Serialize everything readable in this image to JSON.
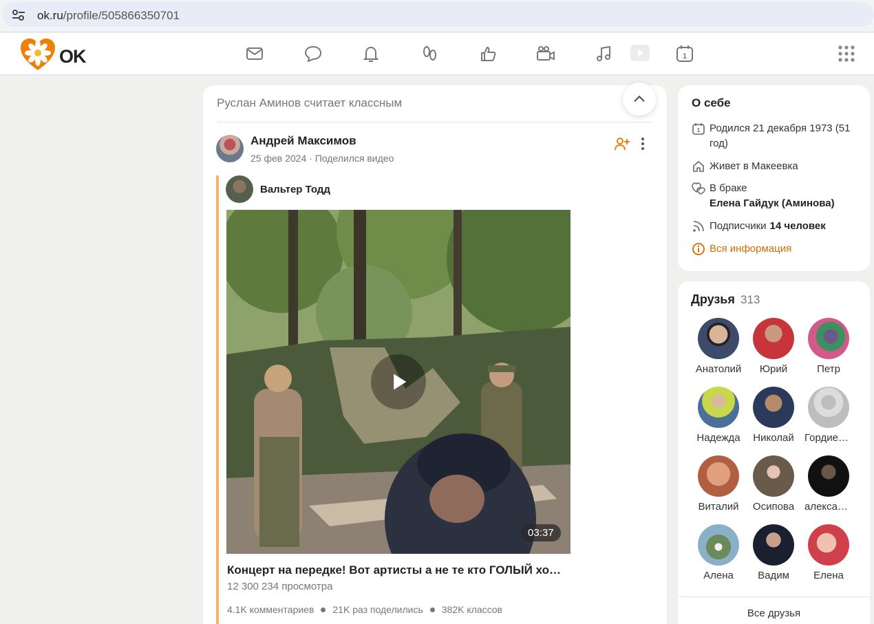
{
  "browser": {
    "url_host": "ok.ru",
    "url_path": "/profile/505866350701"
  },
  "header": {
    "logo_text": "OK",
    "nav_icons": [
      "messages-icon",
      "discussions-icon",
      "notifications-icon",
      "guests-icon",
      "marks-icon",
      "video-icon",
      "music-icon",
      "games-icon",
      "calendar-icon",
      "apps-grid-icon"
    ],
    "accent_color": "#ee8208"
  },
  "feed": {
    "liked_by": "Руслан Аминов считает классным",
    "post": {
      "author": "Андрей Максимов",
      "date": "25 фев 2024",
      "action": "Поделился видео",
      "separator": "·",
      "repost_author": "Вальтер Тодд",
      "video": {
        "duration": "03:37",
        "title": "Концерт на передке! Вот артисты а не те кто ГОЛЫЙ хо…",
        "views": "12 300 234 просмотра"
      },
      "stats": {
        "comments": "4.1K комментариев",
        "shares": "21K раз поделились",
        "likes": "382K классов"
      }
    }
  },
  "about": {
    "title": "О себе",
    "birth": "Родился 21 декабря 1973 (51 год)",
    "lives": "Живет в Макеевка",
    "marital_label": "В браке",
    "spouse": "Елена Гайдук (Аминова)",
    "subscribers_label": "Подписчики",
    "subscribers_count": "14 человек",
    "all_info": "Вся информация"
  },
  "friends": {
    "title": "Друзья",
    "count": "313",
    "items": [
      {
        "name": "Анатолий"
      },
      {
        "name": "Юрий"
      },
      {
        "name": "Петр"
      },
      {
        "name": "Надежда"
      },
      {
        "name": "Николай"
      },
      {
        "name": "Гордиенко"
      },
      {
        "name": "Виталий"
      },
      {
        "name": "Осипова"
      },
      {
        "name": "александр"
      },
      {
        "name": "Алена"
      },
      {
        "name": "Вадим"
      },
      {
        "name": "Елена"
      }
    ],
    "all_label": "Все друзья"
  }
}
